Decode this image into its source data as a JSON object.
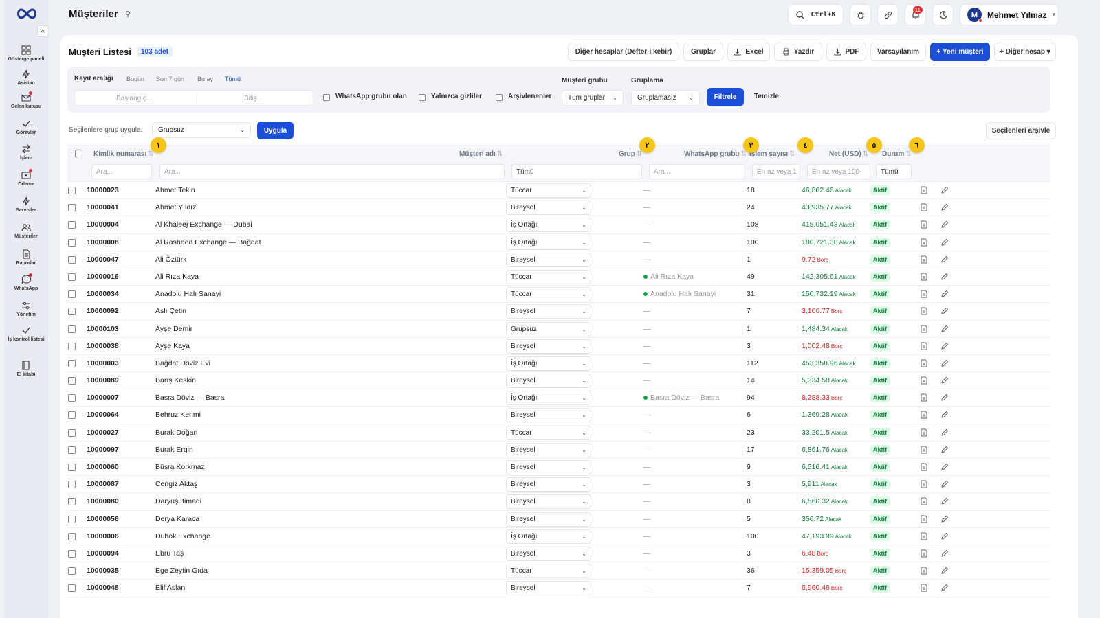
{
  "app": {
    "title": "Müşteriler",
    "title_icon": "pin-icon"
  },
  "sidebar": {
    "collapse_label": "«",
    "items": [
      {
        "label": "Gösterge paneli",
        "icon": "dashboard-icon",
        "dot": false
      },
      {
        "label": "Asistan",
        "icon": "bolt-icon",
        "dot": false
      },
      {
        "label": "Gelen kutusu",
        "icon": "inbox-icon",
        "dot": true
      },
      {
        "label": "Görevler",
        "icon": "check-icon",
        "dot": false
      },
      {
        "label": "İşlem",
        "icon": "swap-icon",
        "dot": false
      },
      {
        "label": "Ödeme",
        "icon": "payment-icon",
        "dot": true
      },
      {
        "label": "Servisler",
        "icon": "bolt-icon",
        "dot": false
      },
      {
        "label": "Müşteriler",
        "icon": "users-icon",
        "dot": false
      },
      {
        "label": "Raporlar",
        "icon": "report-icon",
        "dot": false
      },
      {
        "label": "WhatsApp",
        "icon": "chat-icon",
        "dot": true
      },
      {
        "label": "Yönetim",
        "icon": "sliders-icon",
        "dot": false
      },
      {
        "label": "İş kontrol listesi",
        "icon": "check-icon",
        "dot": false
      },
      {
        "label": "El kitabı",
        "icon": "book-icon",
        "dot": false
      }
    ]
  },
  "topbar": {
    "search_shortcut": "Ctrl+K",
    "notification_count": "11",
    "user": {
      "initial": "M",
      "name": "Mehmet Yılmaz",
      "caret": "▾"
    }
  },
  "list": {
    "title": "Müşteri Listesi",
    "count": "103 adet",
    "actions": {
      "ledger": "Diğer hesaplar (Defter-i kebir)",
      "groups": "Gruplar",
      "excel": "Excel",
      "print": "Yazdır",
      "pdf": "PDF",
      "default": "Varsayılanım",
      "new_customer": "+ Yeni müşteri",
      "other_account": "+ Diğer hesap ▾"
    }
  },
  "filters": {
    "range_label": "Kayıt aralığı",
    "chips": [
      "Bugün",
      "Son 7 gün",
      "Bu ay",
      "Tümü"
    ],
    "active_chip": 3,
    "start_placeholder": "Başlangıç...",
    "end_placeholder": "Bitiş...",
    "checks": [
      "WhatsApp grubu olan",
      "Yalnızca gizliler",
      "Arşivlenenler"
    ],
    "group_label": "Müşteri grubu",
    "group_value": "Tüm gruplar",
    "grouping_label": "Gruplama",
    "grouping_value": "Gruplamasız",
    "filter_btn": "Filtrele",
    "clear_btn": "Temizle"
  },
  "bulk": {
    "label": "Seçilenlere grup uygula:",
    "value": "Grupsuz",
    "apply": "Uygula",
    "archive": "Seçilenleri arşivle"
  },
  "table": {
    "columns": [
      "Kimlik numarası",
      "Müşteri adı",
      "Grup",
      "WhatsApp grubu",
      "İşlem sayısı",
      "Net (USD)",
      "Durum"
    ],
    "sort_glyph": "⇅",
    "filters": {
      "search": "Ara...",
      "all": "Tümü",
      "min_count": "En az veya 1",
      "min_net": "En az veya 100-"
    },
    "markers": [
      "١",
      "٢",
      "٣",
      "٤",
      "٥",
      "٦"
    ],
    "rows": [
      {
        "id": "10000023",
        "name": "Ahmet Tekin",
        "group": "Tüccar",
        "wa": "—",
        "count": "18",
        "net": "46,862.46",
        "dir": "Alacak",
        "status": "Aktif"
      },
      {
        "id": "10000041",
        "name": "Ahmet Yıldız",
        "group": "Bireysel",
        "wa": "—",
        "count": "24",
        "net": "43,935.77",
        "dir": "Alacak",
        "status": "Aktif"
      },
      {
        "id": "10000004",
        "name": "Al Khaleej Exchange — Dubai",
        "group": "İş Ortağı",
        "wa": "—",
        "count": "108",
        "net": "415,051.43",
        "dir": "Alacak",
        "status": "Aktif"
      },
      {
        "id": "10000008",
        "name": "Al Rasheed Exchange — Bağdat",
        "group": "İş Ortağı",
        "wa": "—",
        "count": "100",
        "net": "180,721.38",
        "dir": "Alacak",
        "status": "Aktif"
      },
      {
        "id": "10000047",
        "name": "Ali Öztürk",
        "group": "Bireysel",
        "wa": "—",
        "count": "1",
        "net": "9.72",
        "dir": "Borç",
        "status": "Aktif"
      },
      {
        "id": "10000016",
        "name": "Ali Rıza Kaya",
        "group": "Tüccar",
        "wa": "Ali Rıza Kaya",
        "count": "49",
        "net": "142,305.61",
        "dir": "Alacak",
        "status": "Aktif"
      },
      {
        "id": "10000034",
        "name": "Anadolu Halı Sanayi",
        "group": "Tüccar",
        "wa": "Anadolu Halı Sanayi",
        "count": "31",
        "net": "150,732.19",
        "dir": "Alacak",
        "status": "Aktif"
      },
      {
        "id": "10000092",
        "name": "Aslı Çetin",
        "group": "Bireysel",
        "wa": "—",
        "count": "7",
        "net": "3,100.77",
        "dir": "Borç",
        "status": "Aktif"
      },
      {
        "id": "10000103",
        "name": "Ayşe Demir",
        "group": "Grupsuz",
        "wa": "—",
        "count": "1",
        "net": "1,484.34",
        "dir": "Alacak",
        "status": "Aktif"
      },
      {
        "id": "10000038",
        "name": "Ayşe Kaya",
        "group": "Bireysel",
        "wa": "—",
        "count": "3",
        "net": "1,002.48",
        "dir": "Borç",
        "status": "Aktif"
      },
      {
        "id": "10000003",
        "name": "Bağdat Döviz Evi",
        "group": "İş Ortağı",
        "wa": "—",
        "count": "112",
        "net": "453,358.96",
        "dir": "Alacak",
        "status": "Aktif"
      },
      {
        "id": "10000089",
        "name": "Barış Keskin",
        "group": "Bireysel",
        "wa": "—",
        "count": "14",
        "net": "5,334.58",
        "dir": "Alacak",
        "status": "Aktif"
      },
      {
        "id": "10000007",
        "name": "Basra Döviz — Basra",
        "group": "İş Ortağı",
        "wa": "Basra Döviz — Basra",
        "count": "94",
        "net": "8,288.33",
        "dir": "Borç",
        "status": "Aktif"
      },
      {
        "id": "10000064",
        "name": "Behruz Kerimi",
        "group": "Bireysel",
        "wa": "—",
        "count": "6",
        "net": "1,369.28",
        "dir": "Alacak",
        "status": "Aktif"
      },
      {
        "id": "10000027",
        "name": "Burak Doğan",
        "group": "Tüccar",
        "wa": "—",
        "count": "23",
        "net": "33,201.5",
        "dir": "Alacak",
        "status": "Aktif"
      },
      {
        "id": "10000097",
        "name": "Burak Ergin",
        "group": "Bireysel",
        "wa": "—",
        "count": "17",
        "net": "6,861.76",
        "dir": "Alacak",
        "status": "Aktif"
      },
      {
        "id": "10000060",
        "name": "Büşra Korkmaz",
        "group": "Bireysel",
        "wa": "—",
        "count": "9",
        "net": "6,516.41",
        "dir": "Alacak",
        "status": "Aktif"
      },
      {
        "id": "10000087",
        "name": "Cengiz Aktaş",
        "group": "Bireysel",
        "wa": "—",
        "count": "3",
        "net": "5,911",
        "dir": "Alacak",
        "status": "Aktif"
      },
      {
        "id": "10000080",
        "name": "Daryuş İtimadi",
        "group": "Bireysel",
        "wa": "—",
        "count": "8",
        "net": "6,560.32",
        "dir": "Alacak",
        "status": "Aktif"
      },
      {
        "id": "10000056",
        "name": "Derya Karaca",
        "group": "Bireysel",
        "wa": "—",
        "count": "5",
        "net": "356.72",
        "dir": "Alacak",
        "status": "Aktif"
      },
      {
        "id": "10000006",
        "name": "Duhok Exchange",
        "group": "İş Ortağı",
        "wa": "—",
        "count": "100",
        "net": "47,193.99",
        "dir": "Alacak",
        "status": "Aktif"
      },
      {
        "id": "10000094",
        "name": "Ebru Taş",
        "group": "Bireysel",
        "wa": "—",
        "count": "3",
        "net": "6.48",
        "dir": "Borç",
        "status": "Aktif"
      },
      {
        "id": "10000035",
        "name": "Ege Zeytin Gıda",
        "group": "Tüccar",
        "wa": "—",
        "count": "36",
        "net": "15,359.05",
        "dir": "Borç",
        "status": "Aktif"
      },
      {
        "id": "10000048",
        "name": "Elif Aslan",
        "group": "Bireysel",
        "wa": "—",
        "count": "7",
        "net": "5,960.46",
        "dir": "Borç",
        "status": "Aktif"
      }
    ]
  },
  "colors": {
    "accent": "#1d4ed8",
    "positive": "#15803d",
    "negative": "#dc2626",
    "marker": "#f5c518"
  }
}
